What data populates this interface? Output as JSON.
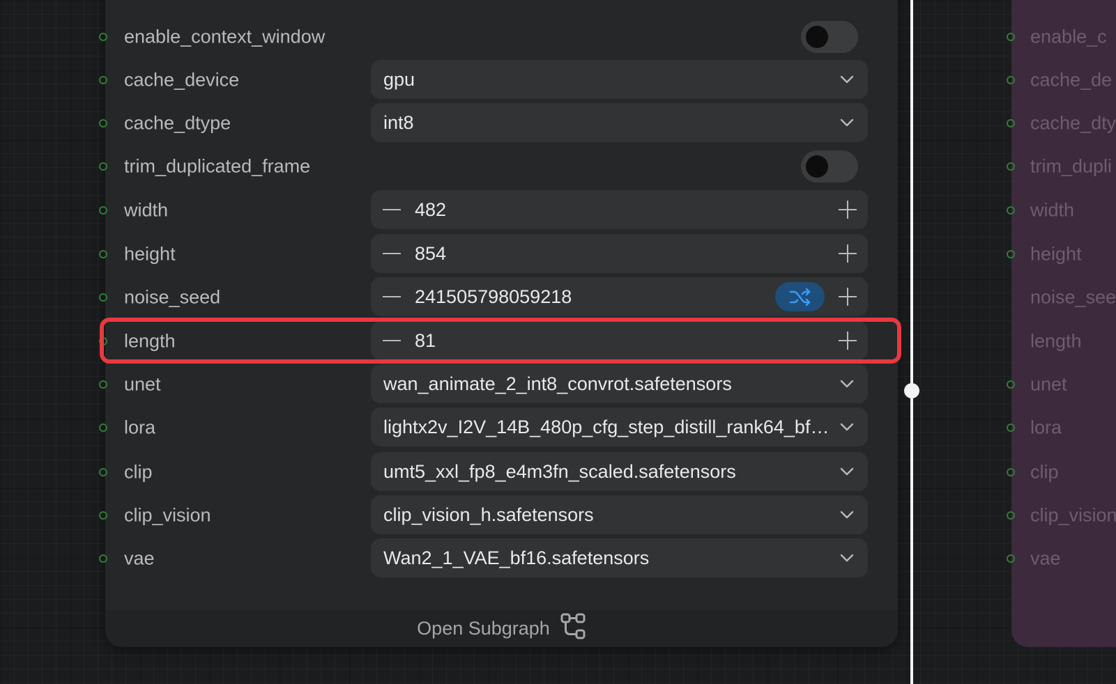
{
  "node": {
    "rows": [
      {
        "key": "enable_context_window",
        "label": "enable_context_window",
        "kind": "toggle",
        "on": false
      },
      {
        "key": "cache_device",
        "label": "cache_device",
        "kind": "combo",
        "value": "gpu"
      },
      {
        "key": "cache_dtype",
        "label": "cache_dtype",
        "kind": "combo",
        "value": "int8"
      },
      {
        "key": "trim_duplicated_frame",
        "label": "trim_duplicated_frame",
        "kind": "toggle",
        "on": false
      },
      {
        "key": "width",
        "label": "width",
        "kind": "number",
        "value": "482"
      },
      {
        "key": "height",
        "label": "height",
        "kind": "number",
        "value": "854"
      },
      {
        "key": "noise_seed",
        "label": "noise_seed",
        "kind": "number",
        "value": "241505798059218",
        "randomize": true
      },
      {
        "key": "length",
        "label": "length",
        "kind": "number",
        "value": "81",
        "highlighted": true
      },
      {
        "key": "unet",
        "label": "unet",
        "kind": "combo",
        "value": "wan_animate_2_int8_convrot.safetensors"
      },
      {
        "key": "lora",
        "label": "lora",
        "kind": "combo",
        "value": "lightx2v_I2V_14B_480p_cfg_step_distill_rank64_bf…"
      },
      {
        "key": "clip",
        "label": "clip",
        "kind": "combo",
        "value": "umt5_xxl_fp8_e4m3fn_scaled.safetensors"
      },
      {
        "key": "clip_vision",
        "label": "clip_vision",
        "kind": "combo",
        "value": "clip_vision_h.safetensors"
      },
      {
        "key": "vae",
        "label": "vae",
        "kind": "combo",
        "value": "Wan2_1_VAE_bf16.safetensors"
      }
    ],
    "footer": {
      "open_subgraph": "Open Subgraph",
      "icon": "subgraph-icon"
    }
  },
  "right_node": {
    "labels": [
      "enable_c",
      "cache_de",
      "cache_dty",
      "trim_dupli",
      "width",
      "height",
      "noise_see",
      "length",
      "unet",
      "lora",
      "clip",
      "clip_vision",
      "vae"
    ]
  },
  "colors": {
    "highlight": "#e8393f",
    "randomize_button": "#1e4e7c",
    "randomize_icon": "#3b9bf2",
    "right_node": "#3d2a3c"
  }
}
